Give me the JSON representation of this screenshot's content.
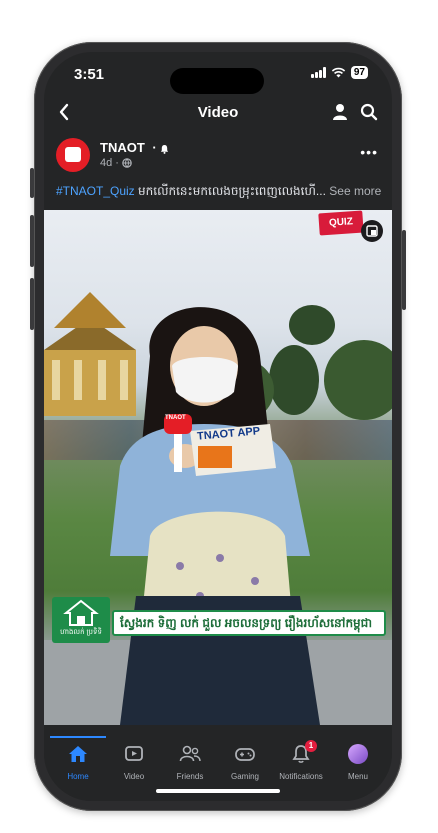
{
  "status_bar": {
    "time": "3:51",
    "battery": "97"
  },
  "header": {
    "title": "Video"
  },
  "post": {
    "author": "TNAOT",
    "author_suffix": "·",
    "time_ago": "4d ·",
    "caption_tag": "#TNAOT_Quiz",
    "caption_text": " មកលើកនេះមកលេងចម្រុះពេញលេងហើ...",
    "see_more": "See more"
  },
  "video": {
    "quiz_badge": "QUIZ",
    "mic_label": "TNAOT",
    "card_label": "TNAOT APP",
    "sponsor_text": "ហាងលក់ ប្រទិទិ",
    "subtitle": "ស្វែងរក ទិញ លក់ ជួល អចលនទ្រព្យ រឿងរហ័សនៅកម្ពុជា"
  },
  "tabs": [
    {
      "label": "Home",
      "icon": "home-icon",
      "active": true
    },
    {
      "label": "Video",
      "icon": "video-icon"
    },
    {
      "label": "Friends",
      "icon": "friends-icon"
    },
    {
      "label": "Gaming",
      "icon": "gaming-icon"
    },
    {
      "label": "Notifications",
      "icon": "bell-icon",
      "badge": "1"
    },
    {
      "label": "Menu",
      "icon": "avatar"
    }
  ],
  "colors": {
    "accent": "#2d88ff",
    "brand_red": "#e41e26",
    "sponsor_green": "#1e8c49",
    "background": "#242526"
  }
}
